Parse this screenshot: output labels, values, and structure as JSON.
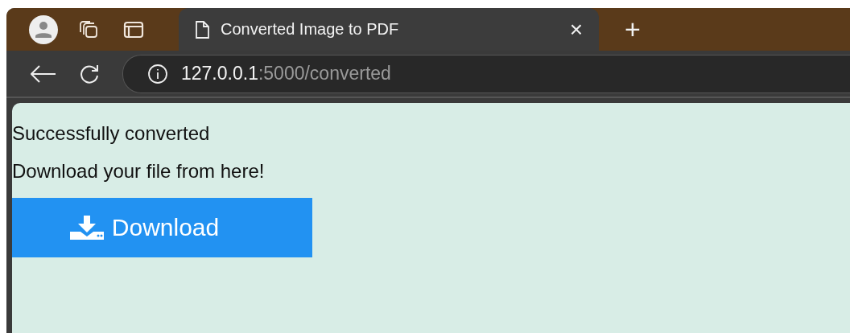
{
  "tabs": [
    {
      "title": "Converted Image to PDF",
      "close": "×",
      "selected": true
    }
  ],
  "new_tab": "+",
  "address_bar": {
    "host": "127.0.0.1",
    "path": ":5000/converted"
  },
  "page": {
    "lines": [
      "Successfully converted",
      "Download your file from here!"
    ],
    "button": {
      "label": "Download"
    }
  }
}
